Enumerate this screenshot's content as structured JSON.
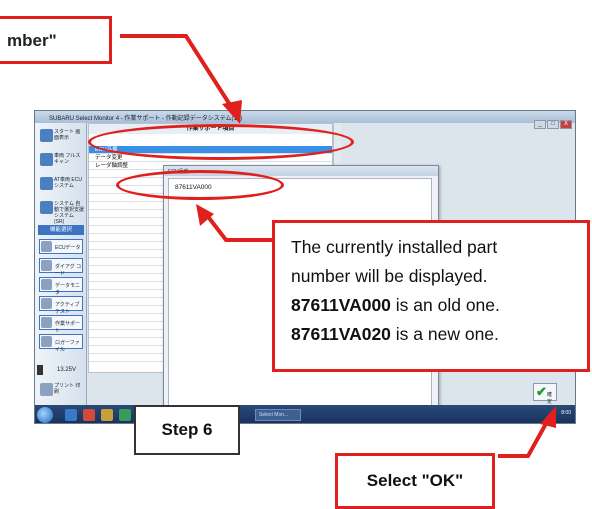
{
  "callouts": {
    "top_label": "mber\"",
    "info_line1": "The currently installed part",
    "info_line2": "number will be displayed.",
    "info_old_part": "87611VA000",
    "info_old_suffix": " is an old one.",
    "info_new_part": "87611VA020",
    "info_new_suffix": " is a new one.",
    "step_label": "Step 6",
    "ok_label": "Select \"OK\""
  },
  "window": {
    "title": "SUBARU Select Monitor 4 - 作業サポート - 作動記録データシステム(14)",
    "buttons": [
      "_",
      "□",
      "X"
    ]
  },
  "sidebar": {
    "items": [
      {
        "label": "スタート 画面表示",
        "icon": "home-icon"
      },
      {
        "label": "車両 フルスキャン",
        "icon": "car-icon"
      },
      {
        "label": "AT車両 ECUシステム",
        "icon": "car-system-icon"
      },
      {
        "label": "システム 自動で選択支援 システム(SR)",
        "icon": "system-select-icon"
      }
    ],
    "section_header": "機能選択",
    "function_buttons": [
      {
        "label": "ECUデータ",
        "icon": "ecu-data-icon"
      },
      {
        "label": "ダイアグ コード",
        "icon": "diag-code-icon"
      },
      {
        "label": "データモニタ",
        "icon": "data-monitor-icon"
      },
      {
        "label": "アクティブテスト",
        "icon": "active-test-icon"
      },
      {
        "label": "作業サポート",
        "icon": "work-support-icon"
      },
      {
        "label": "ロガーファイル",
        "icon": "logger-file-icon"
      }
    ],
    "voltage": "13.25V",
    "print_label": "プリント 印刷"
  },
  "main_panel": {
    "header": "作業サポート項目",
    "rows": [
      "ECU品番",
      "データ変更",
      "レーダ軸調整"
    ]
  },
  "dialog": {
    "title": "ECU品番",
    "part_number": "87611VA000"
  },
  "ok_button": {
    "label": "確定"
  },
  "taskbar": {
    "task_label": "Select Mon...",
    "tray_time": "8:00"
  },
  "colors": {
    "callout_red": "#e0201c",
    "selection_blue": "#3a8ee6",
    "taskbar_blue": "#16305a",
    "ok_green": "#1e9a2e"
  }
}
